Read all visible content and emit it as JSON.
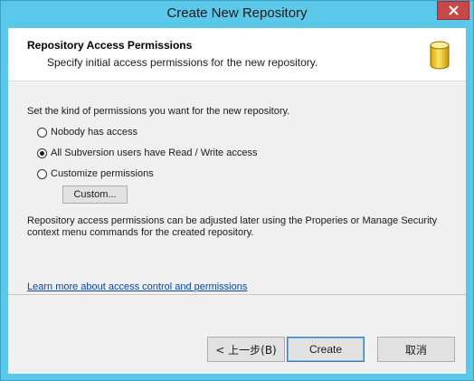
{
  "window": {
    "title": "Create New Repository"
  },
  "header": {
    "title": "Repository Access Permissions",
    "subtitle": "Specify initial access permissions for the new repository.",
    "icon": "database-cylinder-icon"
  },
  "body": {
    "intro": "Set the kind of permissions you want for the new repository.",
    "options": [
      {
        "label": "Nobody has access",
        "checked": false
      },
      {
        "label": "All Subversion users have Read / Write access",
        "checked": true
      },
      {
        "label": "Customize permissions",
        "checked": false
      }
    ],
    "custom_button": "Custom...",
    "note_line1": "Repository access permissions can be adjusted later using the Properies or Manage Security",
    "note_line2": "context menu commands for the created repository.",
    "learn_more": "Learn more about access control and permissions"
  },
  "footer": {
    "back_label": "< 上一步(B)",
    "create_label": "Create",
    "cancel_label": "取消"
  },
  "colors": {
    "chrome": "#5bc8ea",
    "close_button": "#c7484b",
    "link": "#0645ad",
    "default_button_border": "#3c7fb1"
  }
}
